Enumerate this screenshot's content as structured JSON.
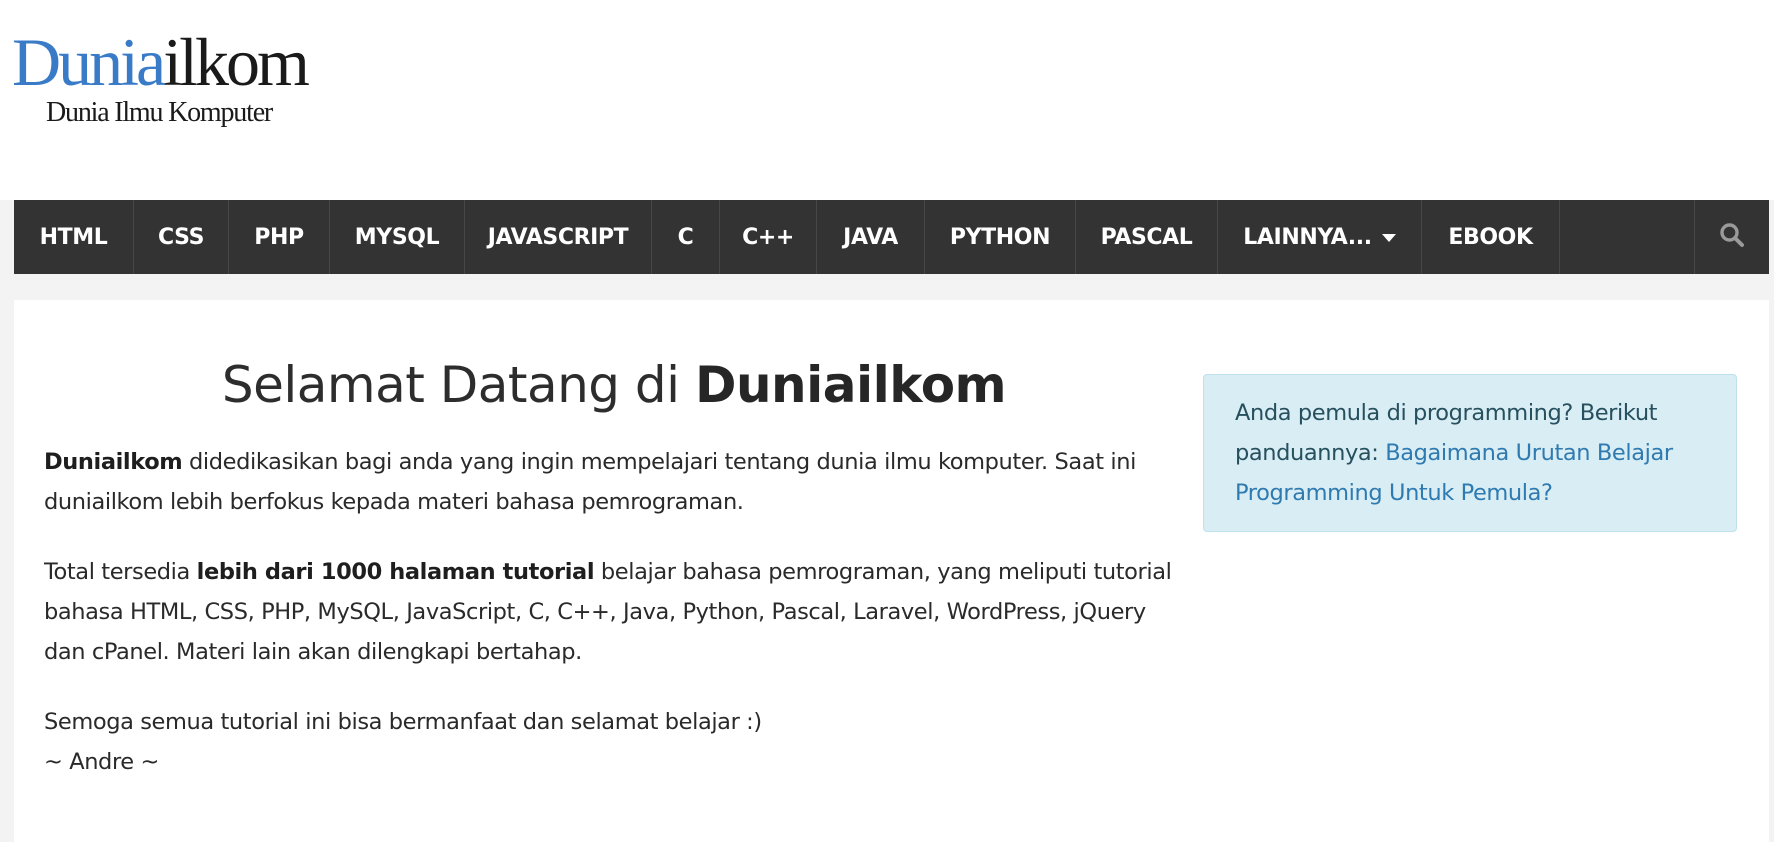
{
  "logo": {
    "part1": "Dunia",
    "part2": "ilkom",
    "tagline": "Dunia Ilmu Komputer",
    "colors": {
      "blue": "#3a7bc8",
      "dark": "#1a1a1a"
    }
  },
  "nav": {
    "items": [
      {
        "label": "HTML"
      },
      {
        "label": "CSS"
      },
      {
        "label": "PHP"
      },
      {
        "label": "MYSQL"
      },
      {
        "label": "JAVASCRIPT"
      },
      {
        "label": "C"
      },
      {
        "label": "C++"
      },
      {
        "label": "JAVA"
      },
      {
        "label": "PYTHON"
      },
      {
        "label": "PASCAL"
      },
      {
        "label": "LAINNYA..."
      },
      {
        "label": "EBOOK"
      }
    ],
    "search_icon": "search-icon",
    "dropdown_icon": "caret-down-icon",
    "background": "#333333"
  },
  "main": {
    "title_prefix": "Selamat Datang di ",
    "title_bold": "Duniailkom",
    "p1_bold": "Duniailkom",
    "p1_text": " didedikasikan bagi anda yang ingin mempelajari tentang dunia ilmu komputer. Saat ini duniailkom lebih berfokus kepada materi bahasa pemrograman.",
    "p2_before": "Total tersedia ",
    "p2_bold": "lebih dari 1000 halaman tutorial",
    "p2_after": " belajar bahasa pemrograman, yang meliputi tutorial bahasa HTML, CSS, PHP, MySQL, JavaScript, C, C++, Java, Python, Pascal, Laravel, WordPress, jQuery dan cPanel. Materi lain akan dilengkapi bertahap.",
    "p3": "Semoga semua tutorial ini bisa bermanfaat dan selamat belajar :)",
    "signature": "~ Andre ~"
  },
  "callout": {
    "text": "Anda pemula di programming? Berikut panduannya: ",
    "link": "Bagaimana Urutan Belajar Programming Untuk Pemula?",
    "background": "#d9edf4",
    "link_color": "#2f7ab0"
  }
}
